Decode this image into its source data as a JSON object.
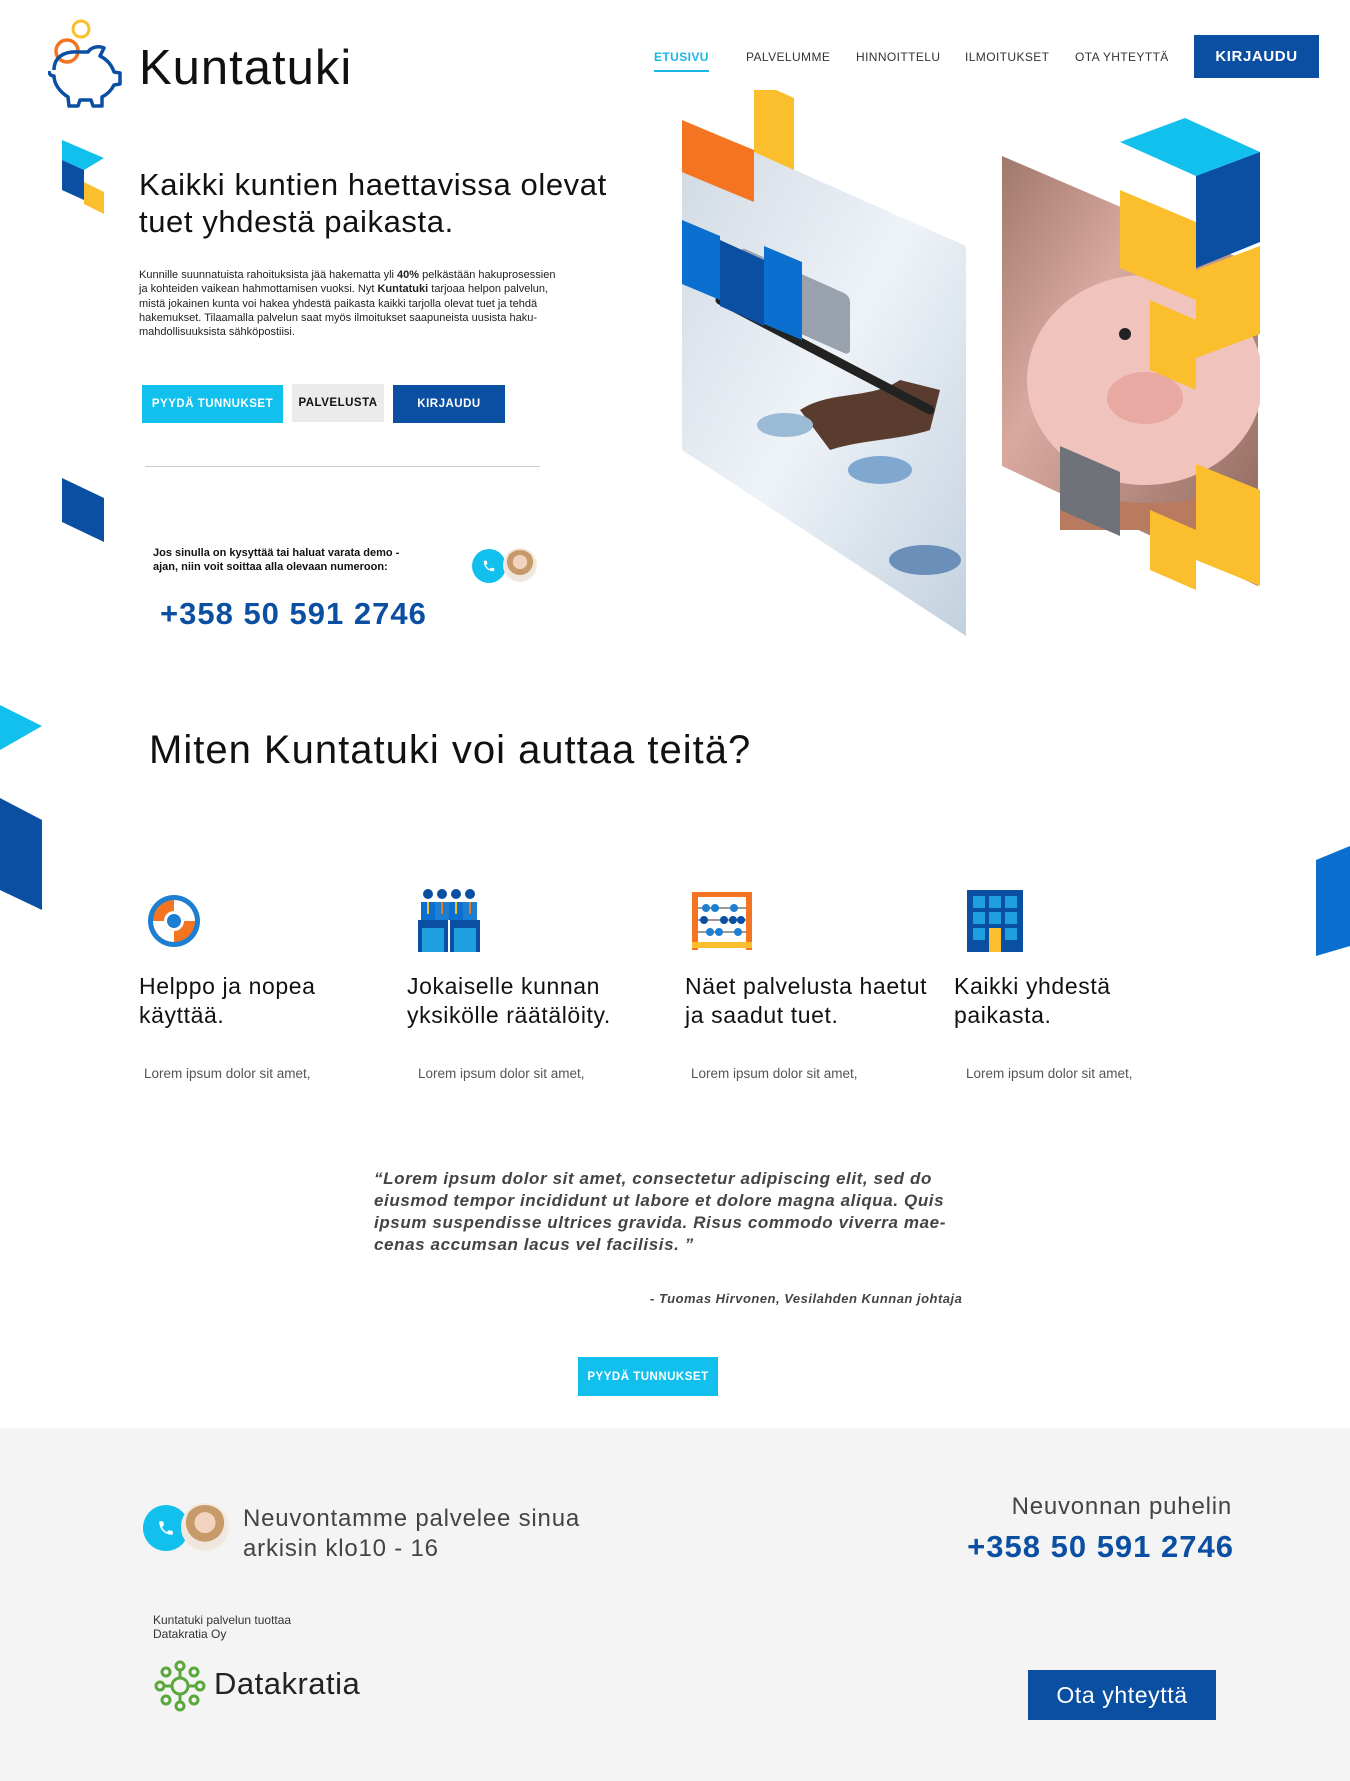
{
  "brand": {
    "name": "Kuntatuki"
  },
  "nav": {
    "items": [
      {
        "label": "ETUSIVU",
        "active": true
      },
      {
        "label": "PALVELUMME"
      },
      {
        "label": "HINNOITTELU"
      },
      {
        "label": "ILMOITUKSET"
      },
      {
        "label": "OTA YHTEYTTÄ"
      }
    ],
    "login_label": "KIRJAUDU"
  },
  "hero": {
    "title": "Kaikki kuntien haettavissa olevat tuet yhdestä paikasta.",
    "desc_part1": "Kunnille suunnatuista rahoituksista jää hakematta yli ",
    "desc_highlight": "40%",
    "desc_part2": " pelkästään hakuprosessien ja kohteiden vaikean hahmottamisen vuoksi. Nyt ",
    "desc_brand": "Kuntatuki",
    "desc_part3": " tarjoaa helpon palvelun, mistä jokainen kunta voi hakea yhdestä paikasta kaikki tarjolla olevat tuet ja tehdä hakemukset. Tilaamalla palvelun saat myös ilmoitukset saapuneista uusista haku-mahdollisuuksista sähköpostiisi.",
    "buttons": {
      "request": "PYYDÄ TUNNUKSET",
      "service": "PALVELUSTA",
      "login": "KIRJAUDU"
    },
    "ask_text": "Jos sinulla on kysyttää tai haluat varata demo -ajan, niin voit soittaa alla olevaan numeroon:",
    "phone": "+358 50 591 2746"
  },
  "help": {
    "title": "Miten Kuntatuki voi auttaa teitä?",
    "features": [
      {
        "icon": "lifebuoy-icon",
        "title": "Helppo ja nopea käyttää.",
        "text": "Lorem ipsum dolor sit amet,"
      },
      {
        "icon": "people-icon",
        "title": "Jokaiselle kunnan yksikölle räätälöity.",
        "text": "Lorem ipsum dolor sit amet,"
      },
      {
        "icon": "abacus-icon",
        "title": "Näet palvelusta haetut ja saadut tuet.",
        "text": "Lorem ipsum dolor sit amet,"
      },
      {
        "icon": "building-icon",
        "title": "Kaikki yhdestä paikasta.",
        "text": "Lorem ipsum dolor sit amet,"
      }
    ]
  },
  "testimonial": {
    "quote": "“Lorem ipsum dolor sit amet, consectetur adipiscing elit, sed do eiusmod tempor incididunt ut labore et dolore magna aliqua. Quis ipsum suspendisse ultrices gravida. Risus commodo viverra mae-cenas accumsan lacus vel facilisis. ”",
    "author": "- Tuomas Hirvonen, Vesilahden Kunnan johtaja",
    "cta": "PYYDÄ TUNNUKSET"
  },
  "footer": {
    "serve_text": "Neuvontamme palvelee sinua arkisin klo10 - 16",
    "phone_label": "Neuvonnan puhelin",
    "phone": "+358 50 591 2746",
    "producer": "Kuntatuki palvelun tuottaa Datakratia Oy",
    "company": "Datakratia",
    "contact_button": "Ota yhteyttä"
  },
  "colors": {
    "primary": "#0a4fa1",
    "accent": "#12c0ee",
    "orange": "#f47421",
    "yellow": "#fbbf2e",
    "footer_bg": "#f4f4f4"
  }
}
